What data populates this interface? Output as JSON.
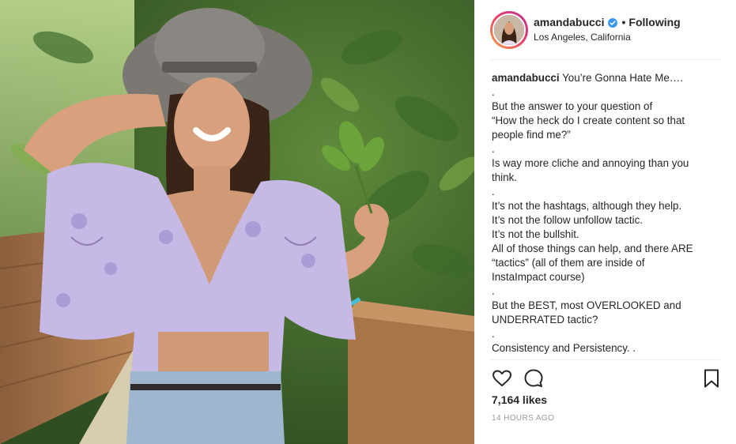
{
  "post": {
    "username": "amandabucci",
    "verified": true,
    "follow_status": "Following",
    "location": "Los Angeles, California",
    "caption_lines": [
      "You’re Gonna Hate Me….",
      ".",
      "But the answer to your question of",
      "“How the heck do I create content so that",
      "people find me?”",
      ".",
      "Is way more cliche and annoying than you",
      "think.",
      ".",
      "It’s not the hashtags, although they help.",
      "It’s not the follow unfollow tactic.",
      "It’s not the bullshit.",
      "All of those things can help, and there ARE",
      "“tactics” (all of them are inside of",
      "InstaImpact course)",
      ".",
      "But the BEST, most OVERLOOKED and",
      "UNDERRATED tactic?",
      ".",
      "Consistency and Persistency. ."
    ],
    "likes": "7,164 likes",
    "time_ago": "14 HOURS AGO"
  },
  "icons": {
    "like": "heart-icon",
    "comment": "comment-icon",
    "save": "bookmark-icon",
    "verified": "verified-badge-icon"
  },
  "colors": {
    "verified_blue": "#3897f0",
    "timestamp_gray": "#999999",
    "divider": "#efefef"
  }
}
